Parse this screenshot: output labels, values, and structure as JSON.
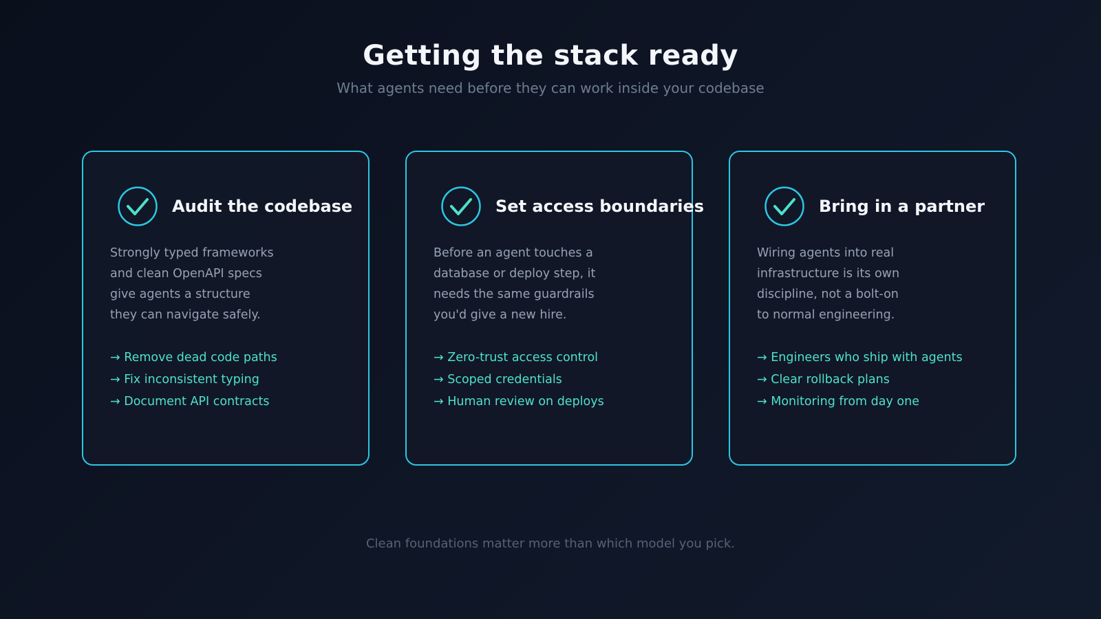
{
  "header": {
    "title": "Getting the stack ready",
    "subtitle": "What agents need before they can work inside your codebase"
  },
  "cards": [
    {
      "icon": "check-circle-icon",
      "title": "Audit the codebase",
      "description_lines": [
        "Strongly typed frameworks",
        "and clean OpenAPI specs",
        "give agents a structure",
        "they can navigate safely."
      ],
      "bullets": [
        "→ Remove dead code paths",
        "→ Fix inconsistent typing",
        "→ Document API contracts"
      ]
    },
    {
      "icon": "check-circle-icon",
      "title": "Set access boundaries",
      "description_lines": [
        "Before an agent touches a",
        "database or deploy step, it",
        "needs the same guardrails",
        "you'd give a new hire."
      ],
      "bullets": [
        "→ Zero-trust access control",
        "→ Scoped credentials",
        "→ Human review on deploys"
      ]
    },
    {
      "icon": "check-circle-icon",
      "title": "Bring in a partner",
      "description_lines": [
        "Wiring agents into real",
        "infrastructure is its own",
        "discipline, not a bolt-on",
        "to normal engineering."
      ],
      "bullets": [
        "→ Engineers who ship with agents",
        "→ Clear rollback plans",
        "→ Monitoring from day one"
      ]
    }
  ],
  "footer": {
    "text": "Clean foundations matter more than which model you pick."
  },
  "colors": {
    "accent_border": "#2cc7e3",
    "accent_check": "#4fe0cb",
    "background": "#0b111d",
    "card_background": "#111827",
    "title_text": "#f3f6fa",
    "body_text": "#97a2b3",
    "muted_text": "#566275"
  }
}
